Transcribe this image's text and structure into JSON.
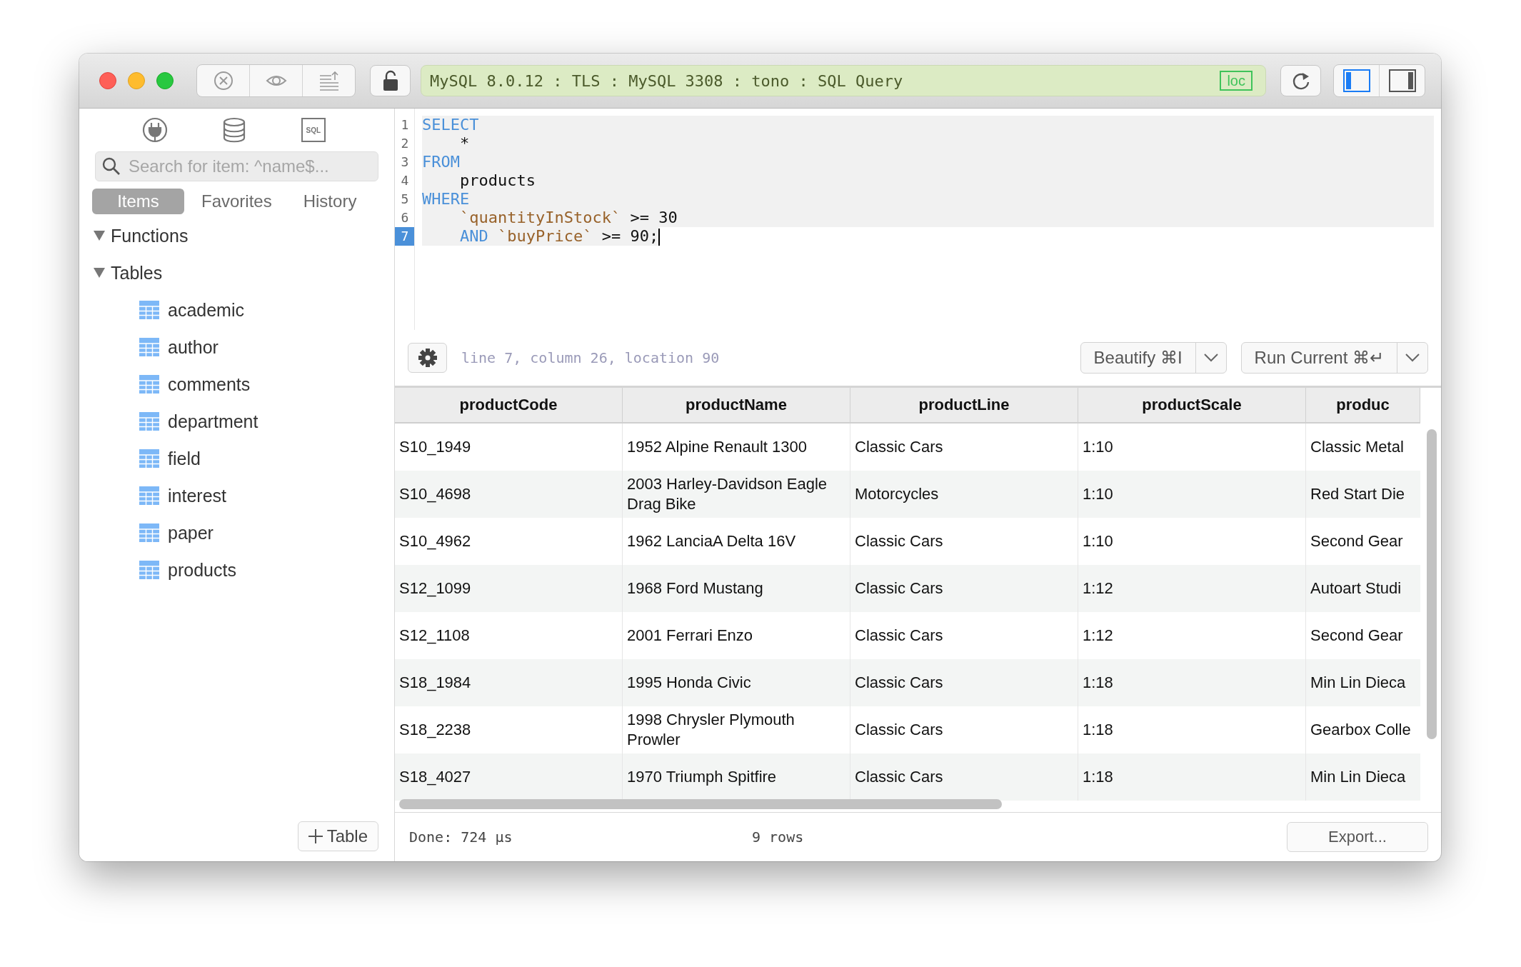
{
  "toolbar": {
    "connection": "MySQL 8.0.12 : TLS : MySQL 3308 : tono : SQL Query",
    "badge": "loc",
    "panel_toggles": [
      {
        "kind": "left",
        "on": true
      },
      {
        "kind": "right",
        "on": false
      }
    ]
  },
  "sidebar": {
    "nav_icons": [
      {
        "kind": "plug"
      },
      {
        "kind": "database"
      },
      {
        "kind": "sql",
        "label": "SQL"
      }
    ],
    "search": {
      "placeholder": "Search for item: ^name$..."
    },
    "tabs": [
      {
        "label": "Items",
        "selected": true
      },
      {
        "label": "Favorites",
        "selected": false
      },
      {
        "label": "History",
        "selected": false
      }
    ],
    "tree": [
      {
        "label": "Functions",
        "expanded": true
      },
      {
        "label": "Tables",
        "expanded": true,
        "children": [
          {
            "label": "academic"
          },
          {
            "label": "author"
          },
          {
            "label": "comments"
          },
          {
            "label": "department"
          },
          {
            "label": "field"
          },
          {
            "label": "interest"
          },
          {
            "label": "paper"
          },
          {
            "label": "products"
          }
        ]
      }
    ],
    "add_button": "Table"
  },
  "editor": {
    "lines": [
      {
        "number": "1",
        "current": false,
        "tokens": [
          {
            "kind": "keyword",
            "text": "SELECT"
          }
        ]
      },
      {
        "number": "2",
        "current": false,
        "tokens": [
          {
            "kind": "plain",
            "text": "    *"
          }
        ]
      },
      {
        "number": "3",
        "current": false,
        "tokens": [
          {
            "kind": "keyword",
            "text": "FROM"
          }
        ]
      },
      {
        "number": "4",
        "current": false,
        "tokens": [
          {
            "kind": "plain",
            "text": "    products"
          }
        ]
      },
      {
        "number": "5",
        "current": false,
        "tokens": [
          {
            "kind": "keyword",
            "text": "WHERE"
          }
        ]
      },
      {
        "number": "6",
        "current": false,
        "tokens": [
          {
            "kind": "ident",
            "text": "    `quantityInStock`"
          },
          {
            "kind": "plain",
            "text": " >= 30"
          }
        ]
      },
      {
        "number": "7",
        "current": true,
        "tokens": [
          {
            "kind": "keyword",
            "text": "    AND"
          },
          {
            "kind": "ident",
            "text": " `buyPrice`"
          },
          {
            "kind": "plain",
            "text": " >= 90;"
          }
        ]
      }
    ],
    "status": "line 7, column 26, location 90",
    "actions": [
      {
        "label": "Beautify ⌘I"
      },
      {
        "label": "Run Current ⌘↵"
      }
    ]
  },
  "results": {
    "columns": [
      "productCode",
      "productName",
      "productLine",
      "productScale",
      "produc"
    ],
    "rows": [
      [
        "S10_1949",
        "1952 Alpine Renault 1300",
        "Classic Cars",
        "1:10",
        "Classic Metal"
      ],
      [
        "S10_4698",
        "2003 Harley-Davidson Eagle Drag Bike",
        "Motorcycles",
        "1:10",
        "Red Start Die"
      ],
      [
        "S10_4962",
        "1962 LanciaA Delta 16V",
        "Classic Cars",
        "1:10",
        "Second Gear"
      ],
      [
        "S12_1099",
        "1968 Ford Mustang",
        "Classic Cars",
        "1:12",
        "Autoart Studi"
      ],
      [
        "S12_1108",
        "2001 Ferrari Enzo",
        "Classic Cars",
        "1:12",
        "Second Gear"
      ],
      [
        "S18_1984",
        "1995 Honda Civic",
        "Classic Cars",
        "1:18",
        "Min Lin Dieca"
      ],
      [
        "S18_2238",
        "1998 Chrysler Plymouth Prowler",
        "Classic Cars",
        "1:18",
        "Gearbox Colle"
      ],
      [
        "S18_4027",
        "1970 Triumph Spitfire",
        "Classic Cars",
        "1:18",
        "Min Lin Dieca"
      ]
    ]
  },
  "footer": {
    "timing": "Done: 724 µs",
    "row_count": "9 rows",
    "export": "Export..."
  }
}
